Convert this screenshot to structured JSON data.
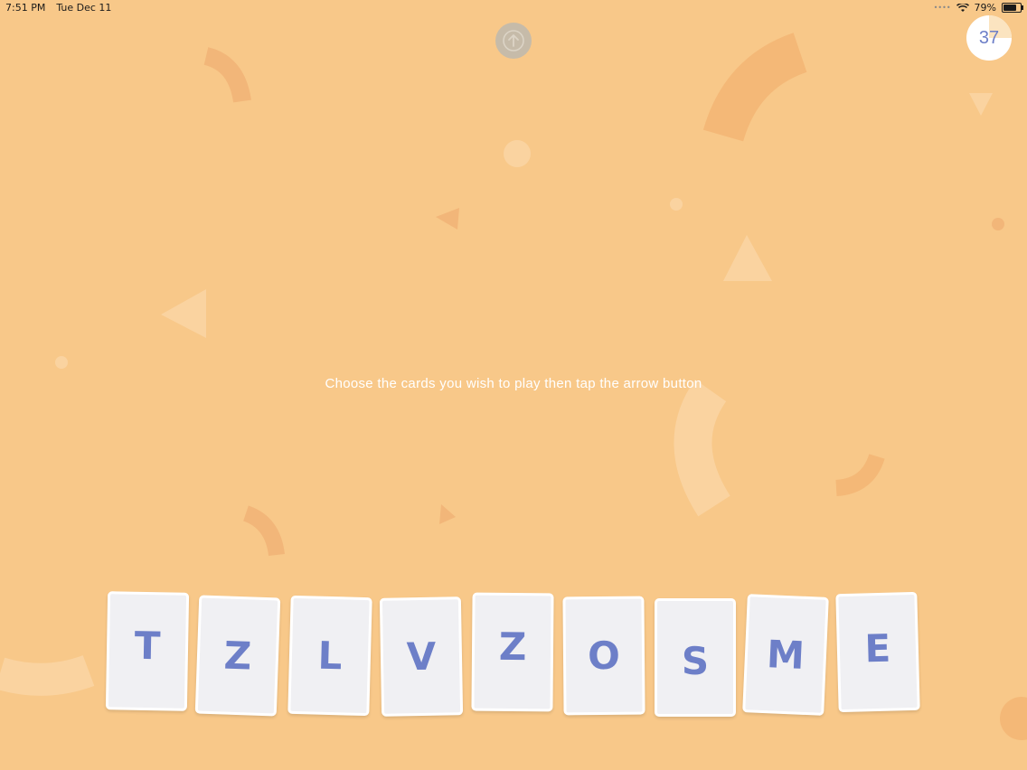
{
  "status_bar": {
    "time": "7:51 PM",
    "date": "Tue Dec 11",
    "battery_percent": "79%",
    "battery_level": 0.79
  },
  "controls": {
    "play_button_icon": "arrow-up-circle-icon",
    "timer_value": "37"
  },
  "instruction": "Choose the cards you wish to play then tap the arrow button",
  "hand": {
    "cards": [
      "T",
      "Z",
      "L",
      "V",
      "Z",
      "O",
      "S",
      "M",
      "E"
    ]
  },
  "colors": {
    "background": "#f8c889",
    "card_letter": "#6d7fc8",
    "card_face": "#f0f0f3"
  }
}
